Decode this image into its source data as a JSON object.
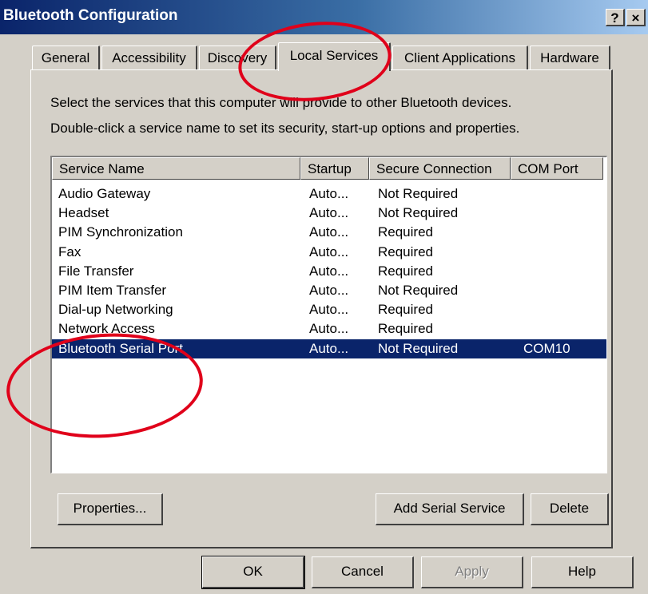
{
  "window": {
    "title": "Bluetooth Configuration",
    "help_button": "?",
    "close_button": "×"
  },
  "tabs": [
    {
      "label": "General"
    },
    {
      "label": "Accessibility"
    },
    {
      "label": "Discovery"
    },
    {
      "label": "Local Services",
      "active": true
    },
    {
      "label": "Client Applications"
    },
    {
      "label": "Hardware"
    }
  ],
  "description": {
    "line1": "Select the services that this computer will provide to other Bluetooth devices.",
    "line2": "Double-click a service name to set its security, start-up options and properties."
  },
  "services_table": {
    "columns": [
      "Service Name",
      "Startup",
      "Secure Connection",
      "COM Port"
    ],
    "rows": [
      {
        "name": "Audio Gateway",
        "startup": "Auto...",
        "secure": "Not Required",
        "com": ""
      },
      {
        "name": "Headset",
        "startup": "Auto...",
        "secure": "Not Required",
        "com": ""
      },
      {
        "name": "PIM Synchronization",
        "startup": "Auto...",
        "secure": "Required",
        "com": ""
      },
      {
        "name": "Fax",
        "startup": "Auto...",
        "secure": "Required",
        "com": ""
      },
      {
        "name": "File Transfer",
        "startup": "Auto...",
        "secure": "Required",
        "com": ""
      },
      {
        "name": "PIM Item Transfer",
        "startup": "Auto...",
        "secure": "Not Required",
        "com": ""
      },
      {
        "name": "Dial-up Networking",
        "startup": "Auto...",
        "secure": "Required",
        "com": ""
      },
      {
        "name": "Network Access",
        "startup": "Auto...",
        "secure": "Required",
        "com": ""
      },
      {
        "name": "Bluetooth Serial Port",
        "startup": "Auto...",
        "secure": "Not Required",
        "com": "COM10",
        "selected": true
      }
    ]
  },
  "buttons": {
    "properties": "Properties...",
    "add_serial_service": "Add Serial Service",
    "delete": "Delete",
    "ok": "OK",
    "cancel": "Cancel",
    "apply": "Apply",
    "help": "Help"
  },
  "colors": {
    "selection": "#0a246a",
    "annotation": "#e0001a"
  }
}
